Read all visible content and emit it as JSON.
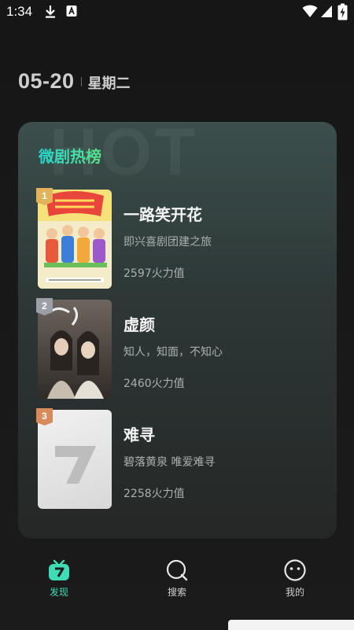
{
  "status_bar": {
    "time": "1:34",
    "icons": [
      "download-icon",
      "a-badge-icon",
      "wifi-icon",
      "signal-icon",
      "battery-charging-icon"
    ]
  },
  "date": {
    "day": "05-20",
    "weekday": "星期二"
  },
  "ranking": {
    "title": "微剧热榜",
    "items": [
      {
        "rank": "1",
        "title": "一路笑开花",
        "subtitle": "即兴喜剧团建之旅",
        "heat": "2597火力值"
      },
      {
        "rank": "2",
        "title": "虚颜",
        "subtitle": "知人，知面，不知心",
        "heat": "2460火力值"
      },
      {
        "rank": "3",
        "title": "难寻",
        "subtitle": "碧落黄泉 唯爱难寻",
        "heat": "2258火力值"
      }
    ]
  },
  "nav": {
    "items": [
      {
        "label": "发现",
        "icon": "tv-icon",
        "active": true
      },
      {
        "label": "搜索",
        "icon": "search-icon",
        "active": false
      },
      {
        "label": "我的",
        "icon": "smiley-icon",
        "active": false
      }
    ]
  },
  "colors": {
    "accent": "#3fdcb6",
    "title_gradient_start": "#25d6d1",
    "title_gradient_end": "#59e38a",
    "background": "#181818"
  }
}
